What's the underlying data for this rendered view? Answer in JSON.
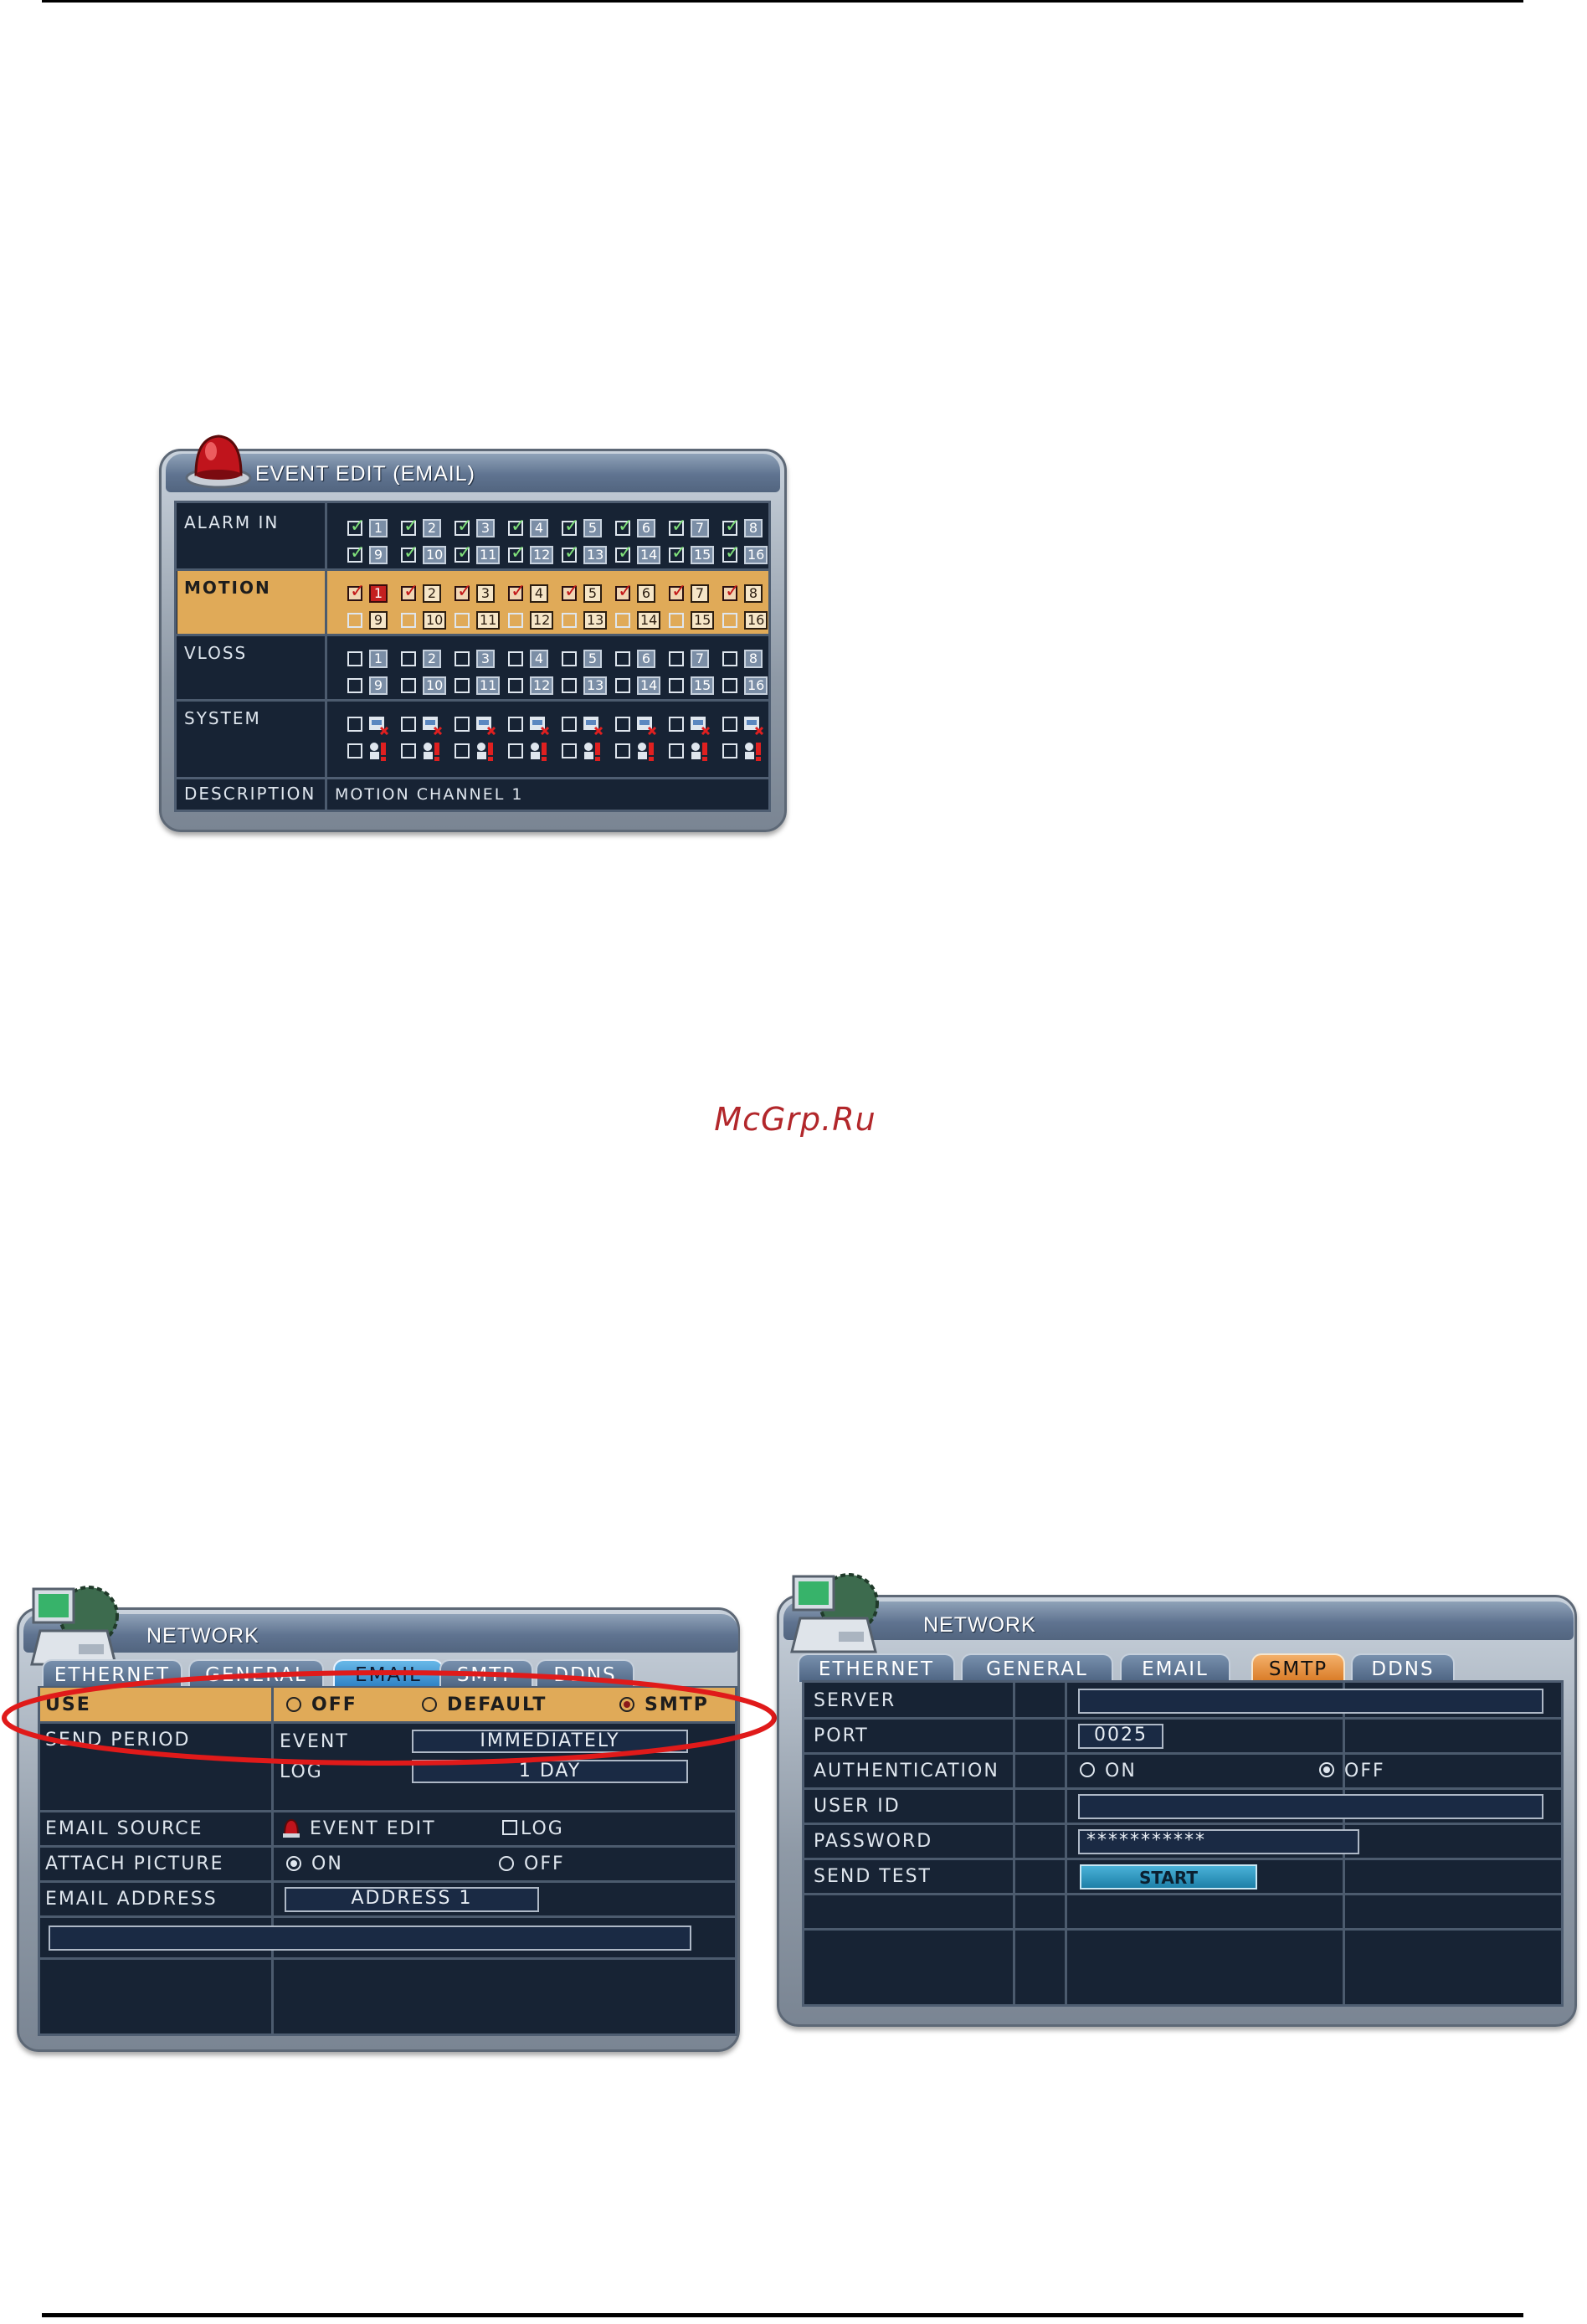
{
  "watermark": "McGrp.Ru",
  "event_edit": {
    "title": "EVENT EDIT (EMAIL)",
    "rows": [
      {
        "label": "ALARM IN"
      },
      {
        "label": "MOTION"
      },
      {
        "label": "VLOSS"
      },
      {
        "label": "SYSTEM"
      }
    ],
    "channels_row1": [
      "1",
      "2",
      "3",
      "4",
      "5",
      "6",
      "7",
      "8"
    ],
    "channels_row2": [
      "9",
      "10",
      "11",
      "12",
      "13",
      "14",
      "15",
      "16"
    ],
    "description_label": "DESCRIPTION",
    "description_value": "MOTION CHANNEL 1",
    "colors": {
      "highlight": "#e0aa58",
      "panel": "#172334"
    }
  },
  "network_email": {
    "title": "NETWORK",
    "tabs": [
      "ETHERNET",
      "GENERAL",
      "EMAIL",
      "SMTP",
      "DDNS"
    ],
    "active_tab": "EMAIL",
    "use": {
      "label": "USE",
      "options": [
        "OFF",
        "DEFAULT",
        "SMTP"
      ],
      "selected": "SMTP"
    },
    "send_period": {
      "label": "SEND PERIOD",
      "event_label": "EVENT",
      "event_value": "IMMEDIATELY",
      "log_label": "LOG",
      "log_value": "1 DAY"
    },
    "email_source": {
      "label": "EMAIL SOURCE",
      "option1": "EVENT EDIT",
      "option2": "LOG"
    },
    "attach_picture": {
      "label": "ATTACH PICTURE",
      "options": [
        "ON",
        "OFF"
      ],
      "selected": "ON"
    },
    "email_address": {
      "label": "EMAIL ADDRESS",
      "value": "ADDRESS 1"
    }
  },
  "network_smtp": {
    "title": "NETWORK",
    "tabs": [
      "ETHERNET",
      "GENERAL",
      "EMAIL",
      "SMTP",
      "DDNS"
    ],
    "active_tab": "SMTP",
    "server": {
      "label": "SERVER",
      "value": ""
    },
    "port": {
      "label": "PORT",
      "value": "0025"
    },
    "authentication": {
      "label": "AUTHENTICATION",
      "options": [
        "ON",
        "OFF"
      ],
      "selected": "OFF"
    },
    "user_id": {
      "label": "USER ID",
      "value": ""
    },
    "password": {
      "label": "PASSWORD",
      "value": "***********"
    },
    "send_test": {
      "label": "SEND TEST",
      "button": "START"
    }
  }
}
